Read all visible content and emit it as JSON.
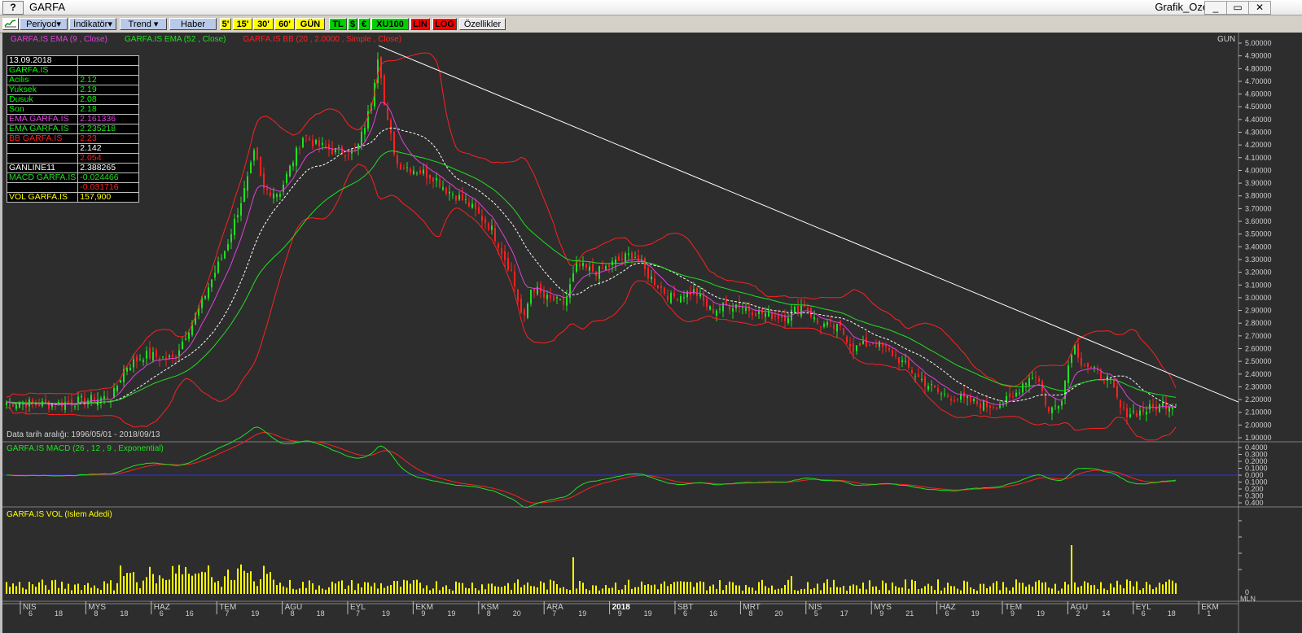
{
  "window": {
    "title": "GARFA",
    "right_title": "Grafik_Ozel",
    "help": "?",
    "minimize": "_",
    "restore": "▭",
    "close": "✕"
  },
  "toolbar": [
    {
      "label": "Periyod▾",
      "kind": "blue"
    },
    {
      "label": "İndikatör▾",
      "kind": "blue"
    },
    {
      "label": "Trend ▾",
      "kind": "blue"
    },
    {
      "label": "Haber",
      "kind": "blue"
    },
    {
      "label": "5'",
      "kind": "yel"
    },
    {
      "label": "15'",
      "kind": "yel"
    },
    {
      "label": "30'",
      "kind": "yel"
    },
    {
      "label": "60'",
      "kind": "yel"
    },
    {
      "label": "GÜN",
      "kind": "yel"
    },
    {
      "label": "TL",
      "kind": "grn"
    },
    {
      "label": "$",
      "kind": "grn"
    },
    {
      "label": "€",
      "kind": "grn"
    },
    {
      "label": "XU100",
      "kind": "grn"
    },
    {
      "label": "LIN",
      "kind": "red"
    },
    {
      "label": "LOG",
      "kind": "red"
    },
    {
      "label": "Özellikler",
      "kind": "gray"
    }
  ],
  "legend": [
    {
      "text": "GARFA.IS EMA (9 , Close)",
      "color": "#e040e0"
    },
    {
      "text": "GARFA.IS EMA (52 , Close)",
      "color": "#20e020"
    },
    {
      "text": "GARFA.IS BB (20 , 2.0000 , Simple , Close)",
      "color": "#ff2020"
    }
  ],
  "period_label": "GUN",
  "info_table": [
    [
      "13.09.2018",
      "",
      "#ffffff",
      "#ffffff"
    ],
    [
      "GARFA.IS",
      "",
      "#00ff00",
      "#00ff00"
    ],
    [
      " Acilis",
      "2.12",
      "#00ff00",
      "#00ff00"
    ],
    [
      " Yuksek",
      "2.19",
      "#00ff00",
      "#00ff00"
    ],
    [
      " Dusuk",
      "2.08",
      "#00ff00",
      "#00ff00"
    ],
    [
      " Son",
      "2.18",
      "#00ff00",
      "#00ff00"
    ],
    [
      "EMA GARFA.IS",
      "2.161336",
      "#e040e0",
      "#e040e0"
    ],
    [
      "EMA GARFA.IS",
      "2.235218",
      "#20e020",
      "#20e020"
    ],
    [
      "BB GARFA.IS",
      "2.23",
      "#ff2020",
      "#ff2020"
    ],
    [
      "",
      "2.142",
      "#ffffff",
      "#ffffff"
    ],
    [
      "",
      "2.054",
      "#ff2020",
      "#ff2020"
    ],
    [
      "GANLINE11",
      "2.388265",
      "#ffffff",
      "#ffffff"
    ],
    [
      "MACD GARFA.IS",
      "-0.024466",
      "#20e020",
      "#20e020"
    ],
    [
      "",
      "-0.031716",
      "#ff2020",
      "#ff2020"
    ],
    [
      "VOL GARFA.IS",
      "157,900",
      "#ffff00",
      "#ffff00"
    ]
  ],
  "data_range": "Data tarih aralığı: 1996/05/01 - 2018/09/13",
  "macd_label": "GARFA.IS MACD (26 , 12 , 9 , Exponential)",
  "vol_label": "GARFA.IS VOL (Islem Adedi)",
  "price_ticks": [
    "5.00000",
    "4.90000",
    "4.80000",
    "4.70000",
    "4.60000",
    "4.50000",
    "4.40000",
    "4.30000",
    "4.20000",
    "4.10000",
    "4.00000",
    "3.90000",
    "3.80000",
    "3.70000",
    "3.60000",
    "3.50000",
    "3.40000",
    "3.30000",
    "3.20000",
    "3.10000",
    "3.00000",
    "2.90000",
    "2.80000",
    "2.70000",
    "2.60000",
    "2.50000",
    "2.40000",
    "2.30000",
    "2.20000",
    "2.10000",
    "2.00000",
    "1.90000"
  ],
  "macd_ticks": [
    "0.4000",
    "0.3000",
    "0.2000",
    "0.1000",
    "0.000",
    "0.1000",
    "0.200",
    "0.300",
    "0.400"
  ],
  "vol_ticks": [
    "0",
    "MLN"
  ],
  "months": [
    {
      "m": "NIS",
      "days": [
        "6",
        "18"
      ]
    },
    {
      "m": "MYS",
      "days": [
        "8",
        "18"
      ]
    },
    {
      "m": "HAZ",
      "days": [
        "6",
        "16"
      ]
    },
    {
      "m": "TEM",
      "days": [
        "7",
        "19"
      ]
    },
    {
      "m": "AGU",
      "days": [
        "8",
        "18"
      ]
    },
    {
      "m": "EYL",
      "days": [
        "7",
        "19"
      ]
    },
    {
      "m": "EKM",
      "days": [
        "9",
        "19"
      ]
    },
    {
      "m": "KSM",
      "days": [
        "8",
        "20"
      ]
    },
    {
      "m": "ARA",
      "days": [
        "7",
        "19"
      ]
    },
    {
      "m": "2018",
      "days": [
        "9",
        "19"
      ]
    },
    {
      "m": "SBT",
      "days": [
        "6",
        "16"
      ]
    },
    {
      "m": "MRT",
      "days": [
        "8",
        "20"
      ]
    },
    {
      "m": "NIS",
      "days": [
        "5",
        "17"
      ]
    },
    {
      "m": "MYS",
      "days": [
        "9",
        "21"
      ]
    },
    {
      "m": "HAZ",
      "days": [
        "6",
        "19"
      ]
    },
    {
      "m": "TEM",
      "days": [
        "9",
        "19"
      ]
    },
    {
      "m": "AGU",
      "days": [
        "2",
        "14"
      ]
    },
    {
      "m": "EYL",
      "days": [
        "6",
        "18"
      ]
    },
    {
      "m": "EKM",
      "days": [
        "1",
        ""
      ]
    }
  ],
  "colors": {
    "bg": "#2d2d2d",
    "grid": "#3a3a3a",
    "up": "#20e020",
    "down": "#ff2020",
    "bb": "#ff2020",
    "ema9": "#e040e0",
    "ema52": "#20e020",
    "trend": "#ffffff",
    "volume": "#ffff00",
    "zero": "#3030ff"
  }
}
